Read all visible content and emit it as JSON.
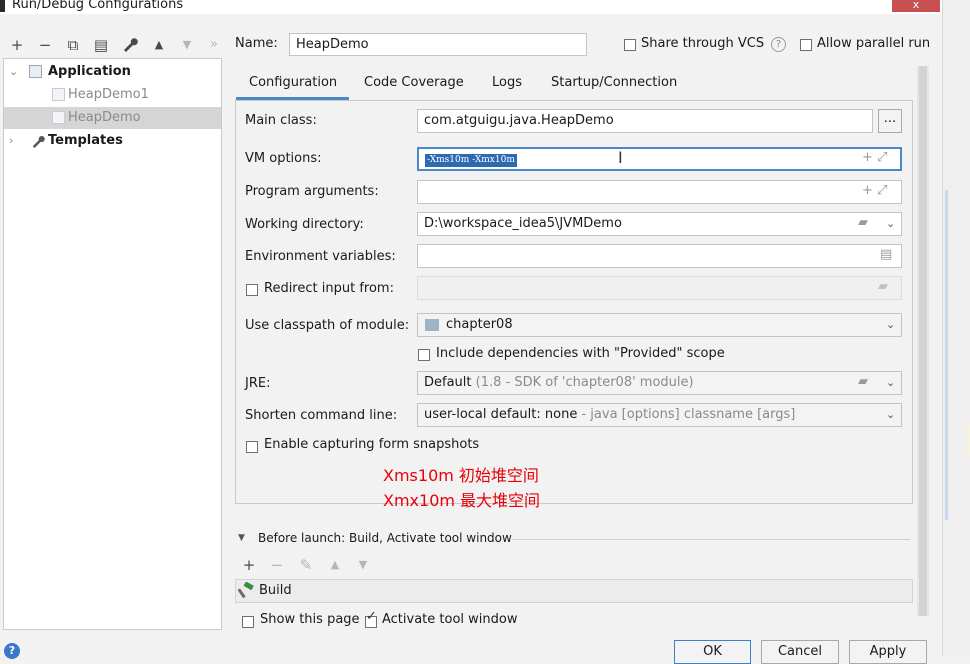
{
  "window": {
    "title": "Run/Debug Configurations",
    "close_glyph": "x"
  },
  "toolbar": {
    "icons": [
      "add-icon",
      "remove-icon",
      "copy-icon",
      "save-icon",
      "wrench-icon",
      "move-up-icon",
      "move-down-icon",
      "more-icon"
    ],
    "add": "+",
    "remove": "−",
    "copy": "⧉",
    "save": "▤",
    "wrench": "🔧",
    "up": "▲",
    "down": "▼",
    "more": "»"
  },
  "tree": {
    "group_application": "Application",
    "items": [
      "HeapDemo1",
      "HeapDemo"
    ],
    "group_templates": "Templates"
  },
  "header": {
    "name_label": "Name:",
    "name_value": "HeapDemo",
    "share_vcs": "Share through VCS",
    "allow_parallel": "Allow parallel run"
  },
  "tabs": [
    "Configuration",
    "Code Coverage",
    "Logs",
    "Startup/Connection"
  ],
  "form": {
    "main_class_label": "Main class:",
    "main_class_value": "com.atguigu.java.HeapDemo",
    "browse_label": "...",
    "vm_options_label": "VM options:",
    "vm_options_value": "-Xms10m -Xmx10m",
    "program_args_label": "Program arguments:",
    "working_dir_label": "Working directory:",
    "working_dir_value": "D:\\workspace_idea5\\JVMDemo",
    "env_vars_label": "Environment variables:",
    "redirect_input_label": "Redirect input from:",
    "classpath_label": "Use classpath of module:",
    "classpath_value": "chapter08",
    "include_deps_label": "Include dependencies with \"Provided\" scope",
    "jre_label": "JRE:",
    "jre_value": "Default",
    "jre_hint": "(1.8 - SDK of 'chapter08' module)",
    "shorten_label": "Shorten command line:",
    "shorten_value": "user-local default: none",
    "shorten_hint": "- java [options] classname [args]",
    "capture_snapshots_label": "Enable capturing form snapshots"
  },
  "annotation": {
    "line1": "Xms10m 初始堆空间",
    "line2": "Xmx10m 最大堆空间",
    "color": "#e8000a"
  },
  "before_launch": {
    "header": "Before launch: Build, Activate tool window",
    "build_item": "Build",
    "show_page": "Show this page",
    "activate_tool_window": "Activate tool window"
  },
  "buttons": {
    "ok": "OK",
    "cancel": "Cancel",
    "apply": "Apply"
  },
  "help_glyph": "?",
  "colors": {
    "selection": "#2e6ab1",
    "accent": "#4a88c7"
  }
}
